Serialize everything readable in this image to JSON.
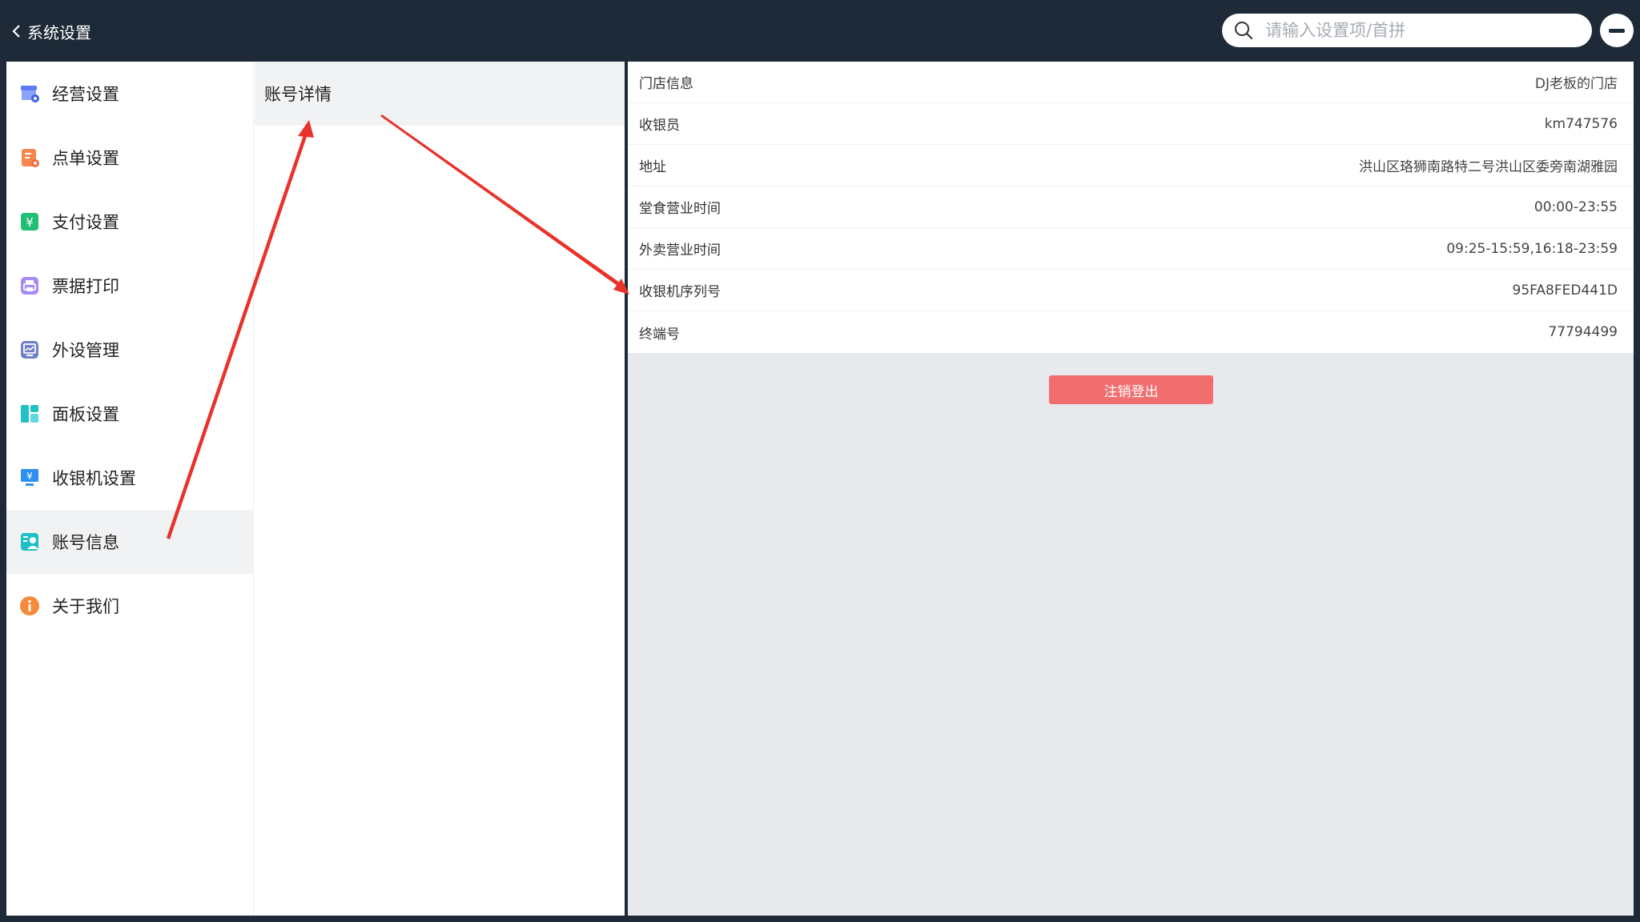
{
  "header": {
    "back_label": "系统设置",
    "search_placeholder": "请输入设置项/首拼"
  },
  "sidebar": {
    "items": [
      {
        "label": "经营设置",
        "icon": "store-settings-icon"
      },
      {
        "label": "点单设置",
        "icon": "order-settings-icon"
      },
      {
        "label": "支付设置",
        "icon": "payment-icon"
      },
      {
        "label": "票据打印",
        "icon": "printer-icon"
      },
      {
        "label": "外设管理",
        "icon": "peripheral-icon"
      },
      {
        "label": "面板设置",
        "icon": "panel-icon"
      },
      {
        "label": "收银机设置",
        "icon": "cash-register-icon"
      },
      {
        "label": "账号信息",
        "icon": "account-icon",
        "active": true
      },
      {
        "label": "关于我们",
        "icon": "info-icon"
      }
    ]
  },
  "submenu": {
    "items": [
      {
        "label": "账号详情"
      }
    ]
  },
  "details": {
    "rows": [
      {
        "label": "门店信息",
        "value": "DJ老板的门店"
      },
      {
        "label": "收银员",
        "value": "km747576"
      },
      {
        "label": "地址",
        "value": "洪山区珞狮南路特二号洪山区委旁南湖雅园"
      },
      {
        "label": "堂食营业时间",
        "value": "00:00-23:55"
      },
      {
        "label": "外卖营业时间",
        "value": "09:25-15:59,16:18-23:59"
      },
      {
        "label": "收银机序列号",
        "value": "95FA8FED441D"
      },
      {
        "label": "终端号",
        "value": "77794499"
      }
    ],
    "logout_label": "注销登出"
  },
  "colors": {
    "header_bg": "#1e2a38",
    "logout_bg": "#f26d6d",
    "annotation_arrow": "#e8322a"
  }
}
